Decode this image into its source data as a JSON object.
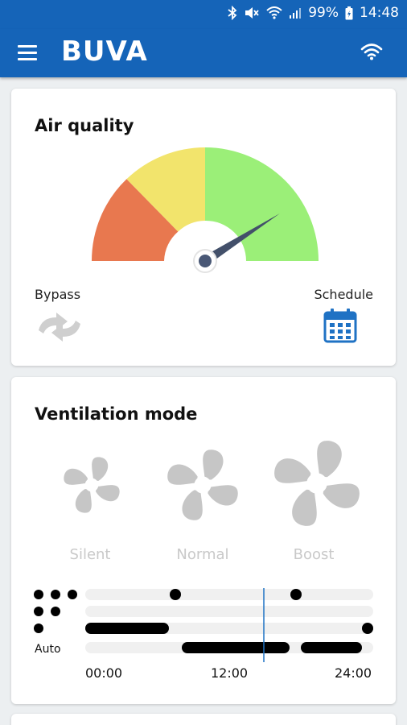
{
  "status": {
    "battery": "99%",
    "time": "14:48",
    "icons": [
      "bluetooth-icon",
      "mute-icon",
      "wifi-icon",
      "signal-icon",
      "battery-icon"
    ]
  },
  "appbar": {
    "brand": "BUVA",
    "menu_icon": "hamburger-menu-icon",
    "connection_icon": "wifi-icon"
  },
  "air_quality": {
    "title": "Air quality",
    "gauge_level": 0.82,
    "gauge_colors": [
      "#e8784f",
      "#f2e46c",
      "#9bef78"
    ],
    "bypass_label": "Bypass",
    "schedule_label": "Schedule",
    "accent": "#1f72c4"
  },
  "ventilation": {
    "title": "Ventilation mode",
    "modes": [
      {
        "label": "Silent",
        "icon": "fan-small-icon"
      },
      {
        "label": "Normal",
        "icon": "fan-medium-icon"
      },
      {
        "label": "Boost",
        "icon": "fan-large-icon"
      }
    ],
    "schedule_rows": [
      "3",
      "2",
      "1",
      "Auto"
    ],
    "auto_label": "Auto",
    "time_labels": [
      "00:00",
      "12:00",
      "24:00"
    ],
    "current_time": "14:48"
  }
}
